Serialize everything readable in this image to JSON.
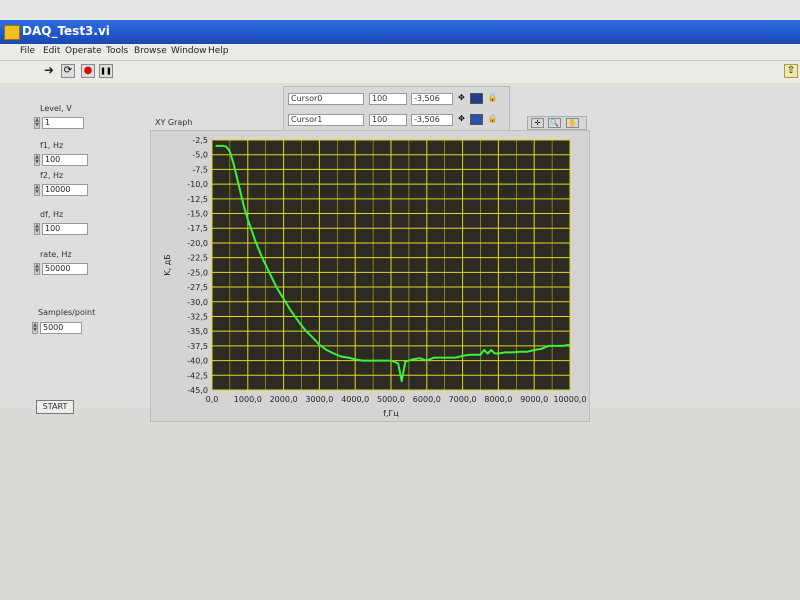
{
  "window": {
    "title": "DAQ_Test3.vi"
  },
  "menu": [
    "File",
    "Edit",
    "Operate",
    "Tools",
    "Browse",
    "Window",
    "Help"
  ],
  "toolbar": {
    "run": "➜",
    "run_cont": "⟳",
    "abort": "●",
    "pause": "❚❚"
  },
  "controls": {
    "level": {
      "label": "Level, V",
      "value": "1"
    },
    "f1": {
      "label": "f1, Hz",
      "value": "100"
    },
    "f2": {
      "label": "f2, Hz",
      "value": "10000"
    },
    "df": {
      "label": "df, Hz",
      "value": "100"
    },
    "rate": {
      "label": "rate, Hz",
      "value": "50000"
    },
    "samples": {
      "label": "Samples/point",
      "value": "5000"
    },
    "start": "START"
  },
  "cursors": [
    {
      "name": "Cursor0",
      "x": "100",
      "y": "-3,506"
    },
    {
      "name": "Cursor1",
      "x": "100",
      "y": "-3,506"
    }
  ],
  "graph": {
    "label": "XY Graph"
  },
  "colors": {
    "plot_bg": "#2b2b24",
    "grid": "#e0d820",
    "trace": "#3cf03c",
    "titlebar": "#2155c8"
  },
  "chart_data": {
    "type": "line",
    "title": "XY Graph",
    "xlabel": "f,Гц",
    "ylabel": "K, дБ",
    "xlim": [
      0,
      10000
    ],
    "ylim": [
      -45,
      -2.5
    ],
    "x_ticks": [
      "0,0",
      "1000,0",
      "2000,0",
      "3000,0",
      "4000,0",
      "5000,0",
      "6000,0",
      "7000,0",
      "8000,0",
      "9000,0",
      "10000,0"
    ],
    "y_ticks": [
      "-2,5",
      "-5,0",
      "-7,5",
      "-10,0",
      "-12,5",
      "-15,0",
      "-17,5",
      "-20,0",
      "-22,5",
      "-25,0",
      "-27,5",
      "-30,0",
      "-32,5",
      "-35,0",
      "-37,5",
      "-40,0",
      "-42,5",
      "-45,0"
    ],
    "series": [
      {
        "x": [
          100,
          200,
          300,
          400,
          500,
          600,
          700,
          800,
          900,
          1000,
          1200,
          1400,
          1600,
          1800,
          2000,
          2200,
          2400,
          2600,
          2800,
          3000,
          3200,
          3400,
          3600,
          3800,
          4000,
          4200,
          4400,
          4600,
          4800,
          5000,
          5100,
          5200,
          5300,
          5400,
          5500,
          5600,
          5800,
          6000,
          6200,
          6400,
          6600,
          6800,
          7000,
          7200,
          7400,
          7500,
          7600,
          7700,
          7800,
          7900,
          8000,
          8200,
          8400,
          8600,
          8800,
          9000,
          9200,
          9400,
          9600,
          9800,
          10000
        ],
        "y": [
          -3.5,
          -3.5,
          -3.5,
          -3.6,
          -4.5,
          -6.5,
          -9,
          -11.5,
          -14,
          -16,
          -19.5,
          -22.5,
          -25,
          -27.5,
          -29.5,
          -31.5,
          -33.2,
          -34.8,
          -36,
          -37.3,
          -38.2,
          -38.8,
          -39.3,
          -39.5,
          -39.8,
          -40,
          -40,
          -40,
          -40,
          -40,
          -40.2,
          -40.5,
          -43.5,
          -40.2,
          -40,
          -39.8,
          -39.6,
          -40,
          -39.5,
          -39.5,
          -39.5,
          -39.5,
          -39.2,
          -39,
          -39,
          -39,
          -38.2,
          -38.8,
          -38.2,
          -38.8,
          -38.8,
          -38.6,
          -38.6,
          -38.5,
          -38.5,
          -38.2,
          -38,
          -37.5,
          -37.5,
          -37.5,
          -37.3
        ]
      }
    ]
  }
}
